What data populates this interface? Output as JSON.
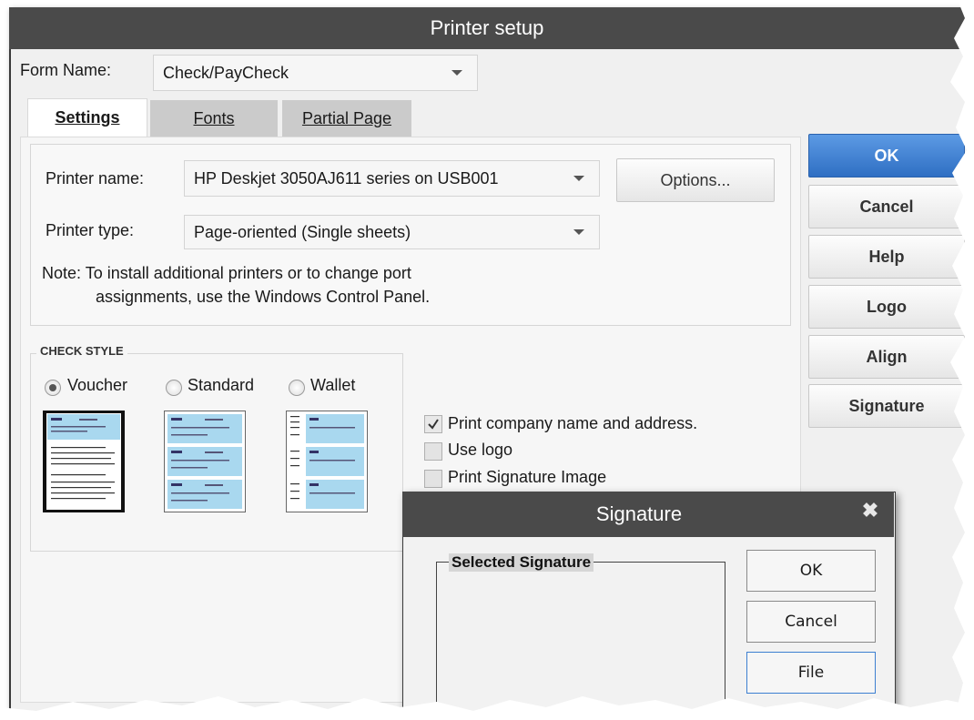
{
  "window": {
    "title": "Printer setup"
  },
  "form": {
    "label": "Form Name:",
    "value": "Check/PayCheck"
  },
  "tabs": [
    {
      "label": "Settings",
      "active": true
    },
    {
      "label": "Fonts",
      "active": false
    },
    {
      "label": "Partial Page",
      "active": false
    }
  ],
  "settings": {
    "printer_name_label": "Printer name:",
    "printer_name_value": "HP Deskjet 3050AJ611 series on USB001",
    "printer_type_label": "Printer type:",
    "printer_type_value": "Page-oriented (Single sheets)",
    "options_label": "Options...",
    "note_line1": "Note: To install additional printers or to change port",
    "note_line2": "assignments, use the Windows Control Panel."
  },
  "check_style": {
    "heading": "CHECK STYLE",
    "options": [
      {
        "label": "Voucher",
        "selected": true
      },
      {
        "label": "Standard",
        "selected": false
      },
      {
        "label": "Wallet",
        "selected": false
      }
    ]
  },
  "checkboxes": [
    {
      "label": "Print company name and address.",
      "checked": true
    },
    {
      "label": "Use logo",
      "checked": false
    },
    {
      "label": "Print Signature Image",
      "checked": false
    }
  ],
  "side_buttons": {
    "ok": "OK",
    "cancel": "Cancel",
    "help": "Help",
    "logo": "Logo",
    "align": "Align",
    "signature": "Signature"
  },
  "signature_dialog": {
    "title": "Signature",
    "group_label": "Selected Signature",
    "ok": "OK",
    "cancel": "Cancel",
    "file": "File"
  },
  "colors": {
    "titlebar": "#4a4a4a",
    "accent": "#3d7fd1",
    "check_blue": "#a9d8ef"
  }
}
